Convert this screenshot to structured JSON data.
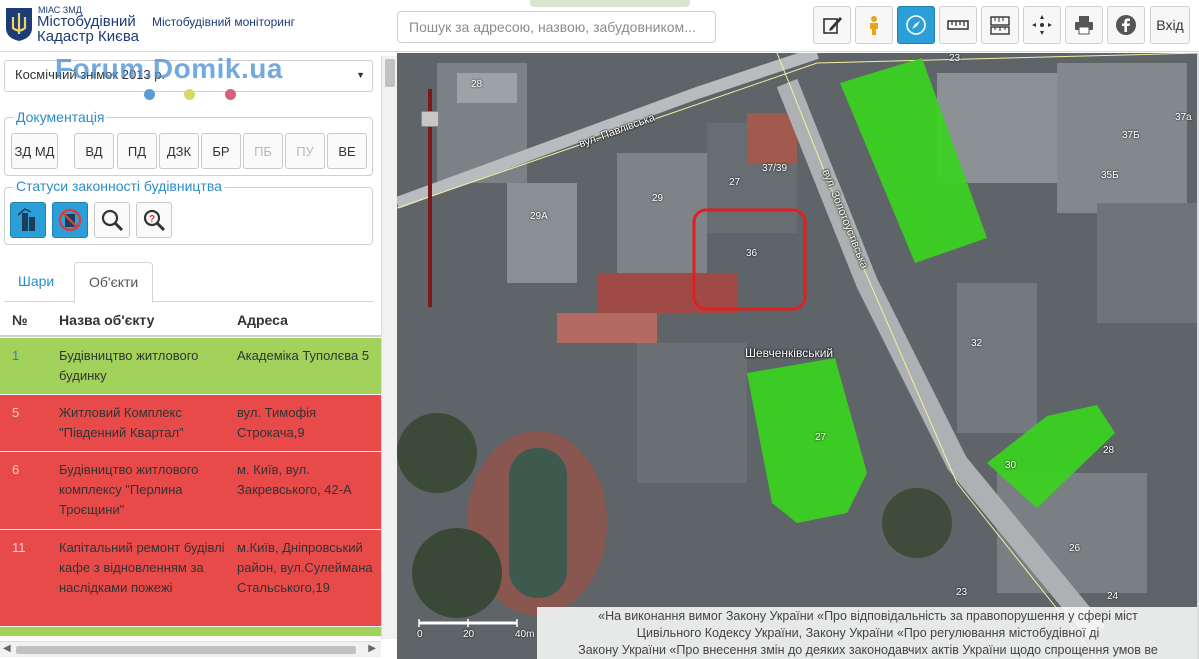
{
  "header": {
    "brand_small": "МІАС ЗМД",
    "brand_line1": "Містобудівний",
    "brand_line2": "Кадастр Києва",
    "subtitle": "Містобудівний моніторинг",
    "search_placeholder": "Пошук за адресою, назвою, забудовником...",
    "login_label": "Вхід",
    "tools": [
      "edit-icon",
      "person-icon",
      "compass-icon",
      "ruler-icon",
      "measure-area-icon",
      "crosshair-icon",
      "print-icon",
      "facebook-icon"
    ]
  },
  "sidebar": {
    "layer_select": "Космічний знімок 2013 р.",
    "watermark": "Forum.Domik.ua",
    "dot_colors": [
      "#5b9bd5",
      "#d6d96a",
      "#d9607a"
    ],
    "documentation": {
      "legend": "Документація",
      "buttons": [
        "ЗД МД",
        "ВД",
        "ПД",
        "ДЗК",
        "БР",
        "ПБ",
        "ПУ",
        "ВЕ"
      ],
      "disabled": [
        "ПБ",
        "ПУ"
      ]
    },
    "statuses": {
      "legend": "Статуси законності будівництва"
    },
    "tabs": [
      "Шари",
      "Об'єкти"
    ],
    "active_tab": "Об'єкти",
    "table": {
      "headers": [
        "№",
        "Назва об'єкту",
        "Адреса"
      ],
      "rows": [
        {
          "num": "1",
          "name": "Будівництво житлового будинку",
          "addr": "Академіка Туполєва 5",
          "status": "green"
        },
        {
          "num": "5",
          "name": "Житловий Комплекс \"Південний Квартал\"",
          "addr": "вул. Тимофія Строкача,9",
          "status": "red"
        },
        {
          "num": "6",
          "name": "Будівництво житлового комплексу \"Перлина Троєщини\"",
          "addr": "м. Київ, вул. Закревського, 42-А",
          "status": "red"
        },
        {
          "num": "11",
          "name": "Капітальний ремонт будівлі кафе з відновленням за наслідками пожежі",
          "addr": "м.Київ, Дніпровський район, вул.Сулеймана Стальського,19",
          "status": "red"
        }
      ]
    }
  },
  "map": {
    "streets": [
      "вул. Павлівська",
      "вул. Золотоустівська"
    ],
    "district": "Шевченківський",
    "building_labels": [
      "23",
      "28",
      "37/39",
      "27",
      "29",
      "29А",
      "36",
      "37Б",
      "35Б",
      "37а",
      "32",
      "27",
      "30",
      "28",
      "26",
      "23",
      "24"
    ],
    "scale_labels": [
      "0",
      "20",
      "40m"
    ],
    "notice_lines": [
      "«На виконання вимог Закону України «Про відповідальність за правопорушення у сфері міст",
      "Цивільного Кодексу України, Закону України «Про регулювання містобудівної ді",
      "Закону України «Про внесення змін до деяких законодавчих актів України щодо спрощення умов ве"
    ],
    "colors": {
      "highlight": "#39d21f",
      "marker": "#e02020"
    }
  }
}
